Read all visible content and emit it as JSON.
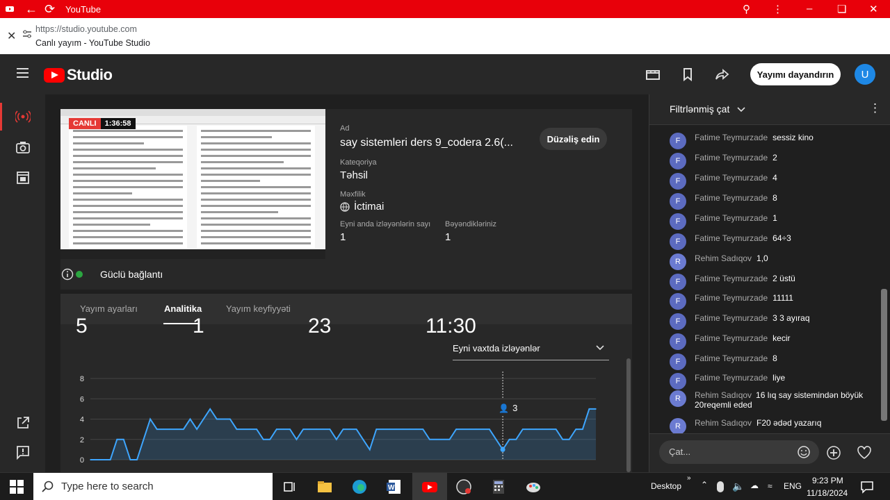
{
  "titlebar": {
    "app_title": "YouTube"
  },
  "urlbar": {
    "url": "https://studio.youtube.com",
    "page_title": "Canlı yayım - YouTube Studio"
  },
  "header": {
    "logo_text": "Studio",
    "end_stream_label": "Yayımı dayandırın",
    "avatar_letter": "U"
  },
  "stream": {
    "live_label": "CANLI",
    "elapsed": "1:36:58",
    "title_label": "Ad",
    "title": "say sistemleri ders 9_codera 2.6(...",
    "category_label": "Kateqoriya",
    "category": "Təhsil",
    "privacy_label": "Məxfilik",
    "privacy": "İctimai",
    "concurrent_label": "Eyni anda izləyənlərin sayı",
    "concurrent": "1",
    "likes_label": "Bəyəndikləriniz",
    "likes": "1",
    "edit_label": "Düzəliş edin",
    "connection": "Güclü bağlantı"
  },
  "tabs": [
    {
      "label": "Yayım ayarları",
      "selected": false
    },
    {
      "label": "Analitika",
      "selected": true
    },
    {
      "label": "Yayım keyfiyyəti",
      "selected": false
    }
  ],
  "analytics": {
    "stats": [
      "5",
      "1",
      "23",
      "11:30"
    ],
    "dropdown_label": "Eyni vaxtda izləyənlər",
    "hover_value": "3"
  },
  "chart_data": {
    "type": "area",
    "title": "",
    "ylabel": "",
    "xlabel": "",
    "ylim": [
      0,
      8
    ],
    "y_ticks": [
      "8",
      "6",
      "4",
      "2",
      "0"
    ],
    "grid": true,
    "series": [
      {
        "values": [
          0,
          0,
          0,
          0,
          2,
          2,
          0,
          0,
          2,
          4,
          3,
          3,
          3,
          3,
          3,
          4,
          3,
          4,
          5,
          4,
          4,
          4,
          3,
          3,
          3,
          3,
          2,
          2,
          3,
          3,
          3,
          2,
          3,
          3,
          3,
          3,
          3,
          2,
          3,
          3,
          3,
          2,
          1,
          3,
          3,
          3,
          3,
          3,
          3,
          3,
          3,
          2,
          2,
          2,
          2,
          3,
          3,
          3,
          3,
          3,
          3,
          2,
          1,
          2,
          2,
          3,
          3,
          3,
          3,
          3,
          3,
          2,
          2,
          3,
          3,
          5,
          5
        ]
      }
    ]
  },
  "chat": {
    "header": "Filtrlənmiş çat",
    "messages": [
      {
        "initial": "F",
        "author": "Fatime Teymurzade",
        "text": "sessiz kino"
      },
      {
        "initial": "F",
        "author": "Fatime Teymurzade",
        "text": "2"
      },
      {
        "initial": "F",
        "author": "Fatime Teymurzade",
        "text": "4"
      },
      {
        "initial": "F",
        "author": "Fatime Teymurzade",
        "text": "8"
      },
      {
        "initial": "F",
        "author": "Fatime Teymurzade",
        "text": "1"
      },
      {
        "initial": "F",
        "author": "Fatime Teymurzade",
        "text": "64÷3"
      },
      {
        "initial": "R",
        "author": "Rehim Sadıqov",
        "text": "1,0"
      },
      {
        "initial": "F",
        "author": "Fatime Teymurzade",
        "text": "2 üstü"
      },
      {
        "initial": "F",
        "author": "Fatime Teymurzade",
        "text": "11111"
      },
      {
        "initial": "F",
        "author": "Fatime Teymurzade",
        "text": "3 3 ayıraq"
      },
      {
        "initial": "F",
        "author": "Fatime Teymurzade",
        "text": "kecir"
      },
      {
        "initial": "F",
        "author": "Fatime Teymurzade",
        "text": "8"
      },
      {
        "initial": "F",
        "author": "Fatime Teymurzade",
        "text": "liye"
      },
      {
        "initial": "R",
        "author": "Rehim Sadıqov",
        "text": "16 lıq say sistemindən böyük 20reqemli eded"
      },
      {
        "initial": "R",
        "author": "Rehim Sadıqov",
        "text": "F20 ədəd yazarıq"
      }
    ],
    "input_placeholder": "Çat..."
  },
  "taskbar": {
    "search_placeholder": "Type here to search",
    "desktop_label": "Desktop",
    "language": "ENG",
    "time": "9:23 PM",
    "date": "11/18/2024"
  },
  "colors": {
    "youtube_red": "#ff0000",
    "titlebar_red": "#e8000a",
    "chart_line": "#3ea6ff",
    "bg": "#1f1f1f"
  }
}
